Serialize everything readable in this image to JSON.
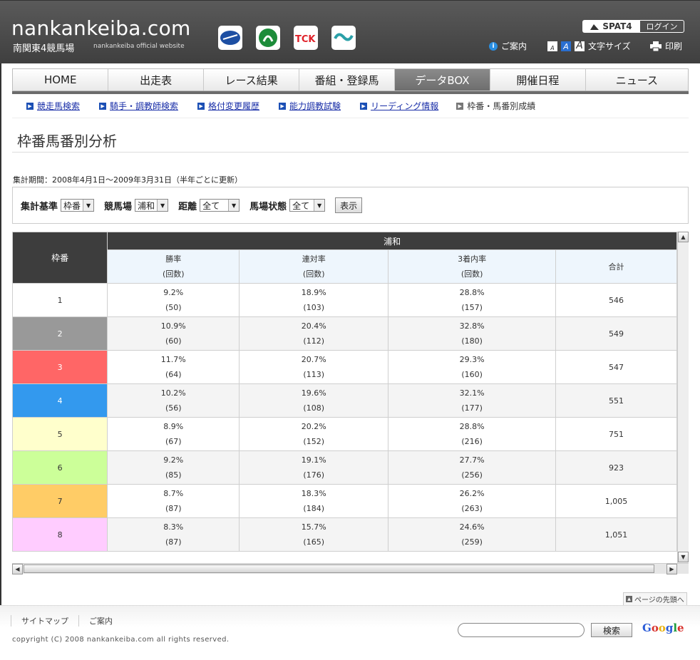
{
  "header": {
    "site_name": "nankankeiba.com",
    "subtitle": "南関東4競馬場",
    "tagline": "nankankeiba official website",
    "spat4_label": "SPAT4",
    "login_label": "ログイン",
    "guide_label": "ご案内",
    "font_size_label": "文字サイズ",
    "print_label": "印刷"
  },
  "global_nav": [
    "HOME",
    "出走表",
    "レース結果",
    "番組・登録馬",
    "データBOX",
    "開催日程",
    "ニュース"
  ],
  "sub_nav": {
    "links": [
      "競走馬検索",
      "騎手・調教師検索",
      "格付変更履歴",
      "能力調教試験",
      "リーディング情報"
    ],
    "current": "枠番・馬番別成績"
  },
  "page_title": "枠番馬番別分析",
  "period_text": "集計期間：2008年4月1日〜2009年3月31日（半年ごとに更新）",
  "filters": {
    "basis_label": "集計基準",
    "basis_value": "枠番",
    "course_label": "競馬場",
    "course_value": "浦和",
    "distance_label": "距離",
    "distance_value": "全て",
    "condition_label": "馬場状態",
    "condition_value": "全て",
    "show_label": "表示"
  },
  "table": {
    "col_waku": "枠番",
    "course_header": "浦和",
    "col_win": "勝率",
    "col_place": "連対率",
    "col_show": "3着内率",
    "count_label": "(回数)",
    "col_total": "合計",
    "rows": [
      {
        "waku": "1",
        "win": "9.2%",
        "win_n": "(50)",
        "place": "18.9%",
        "place_n": "(103)",
        "show": "28.8%",
        "show_n": "(157)",
        "total": "546"
      },
      {
        "waku": "2",
        "win": "10.9%",
        "win_n": "(60)",
        "place": "20.4%",
        "place_n": "(112)",
        "show": "32.8%",
        "show_n": "(180)",
        "total": "549"
      },
      {
        "waku": "3",
        "win": "11.7%",
        "win_n": "(64)",
        "place": "20.7%",
        "place_n": "(113)",
        "show": "29.3%",
        "show_n": "(160)",
        "total": "547"
      },
      {
        "waku": "4",
        "win": "10.2%",
        "win_n": "(56)",
        "place": "19.6%",
        "place_n": "(108)",
        "show": "32.1%",
        "show_n": "(177)",
        "total": "551"
      },
      {
        "waku": "5",
        "win": "8.9%",
        "win_n": "(67)",
        "place": "20.2%",
        "place_n": "(152)",
        "show": "28.8%",
        "show_n": "(216)",
        "total": "751"
      },
      {
        "waku": "6",
        "win": "9.2%",
        "win_n": "(85)",
        "place": "19.1%",
        "place_n": "(176)",
        "show": "27.7%",
        "show_n": "(256)",
        "total": "923"
      },
      {
        "waku": "7",
        "win": "8.7%",
        "win_n": "(87)",
        "place": "18.3%",
        "place_n": "(184)",
        "show": "26.2%",
        "show_n": "(263)",
        "total": "1,005"
      },
      {
        "waku": "8",
        "win": "8.3%",
        "win_n": "(87)",
        "place": "15.7%",
        "place_n": "(165)",
        "show": "24.6%",
        "show_n": "(259)",
        "total": "1,051"
      }
    ],
    "waku_colors": [
      "#ffffff",
      "#999999",
      "#ff6666",
      "#3399ee",
      "#ffffcc",
      "#ccff99",
      "#ffcc66",
      "#ffccff"
    ],
    "waku_text_colors": [
      "#333333",
      "#ffffff",
      "#ffffff",
      "#ffffff",
      "#333333",
      "#333333",
      "#333333",
      "#333333"
    ]
  },
  "page_top_label": "ページの先頭へ",
  "footer": {
    "links": [
      "サイトマップ",
      "ご案内"
    ],
    "copyright": "copyright (C) 2008 nankankeiba.com all rights reserved.",
    "search_button": "検索",
    "google_label": "Google"
  }
}
